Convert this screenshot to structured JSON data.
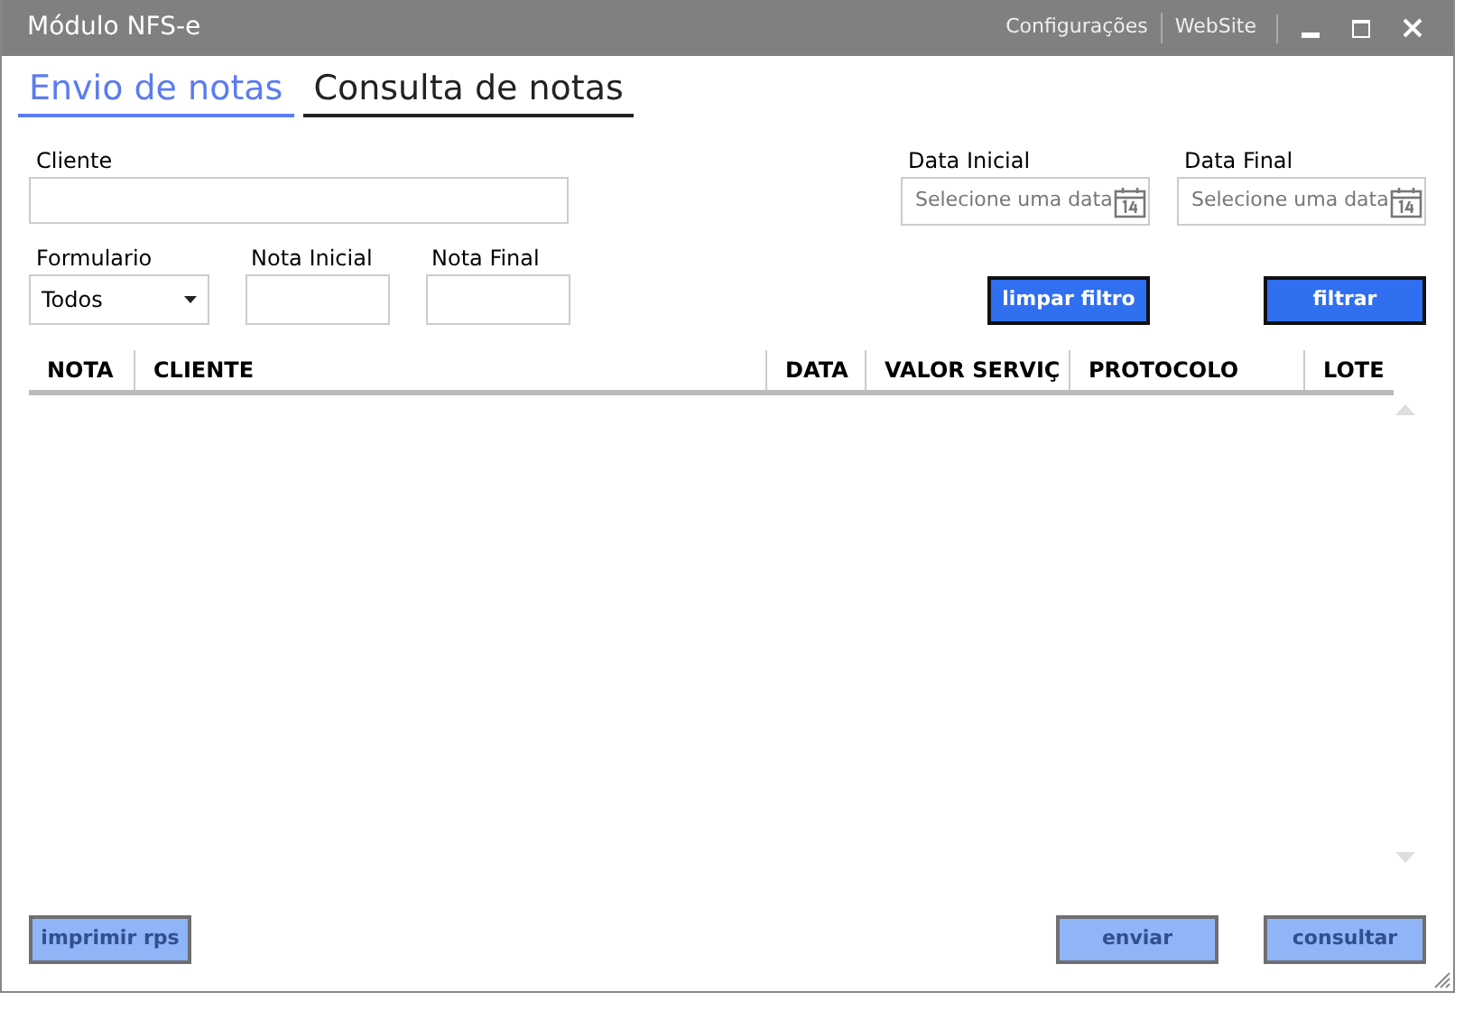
{
  "window": {
    "title": "Módulo NFS-e",
    "links": [
      "Configurações",
      "WebSite"
    ]
  },
  "tabs": [
    {
      "label": "Envio de notas",
      "selected": true
    },
    {
      "label": "Consulta de notas",
      "selected": false
    }
  ],
  "filters": {
    "cliente": {
      "label": "Cliente"
    },
    "data_inicial": {
      "label": "Data Inicial",
      "placeholder": "Selecione uma data"
    },
    "data_final": {
      "label": "Data Final",
      "placeholder": "Selecione uma data"
    },
    "formulario": {
      "label": "Formulario",
      "value": "Todos"
    },
    "nota_inicial": {
      "label": "Nota Inicial"
    },
    "nota_final": {
      "label": "Nota Final"
    }
  },
  "filter_buttons": [
    {
      "label": "limpar filtro",
      "disabled": false
    },
    {
      "label": "filtrar",
      "disabled": false
    }
  ],
  "table": {
    "columns": [
      "NOTA",
      "CLIENTE",
      "DATA",
      "VALOR SERVIÇ",
      "PROTOCOLO",
      "LOTE"
    ]
  },
  "footer_buttons": [
    {
      "label": "imprimir rps",
      "disabled": true
    },
    {
      "label": "enviar",
      "disabled": true
    },
    {
      "label": "consultar",
      "disabled": true
    }
  ]
}
